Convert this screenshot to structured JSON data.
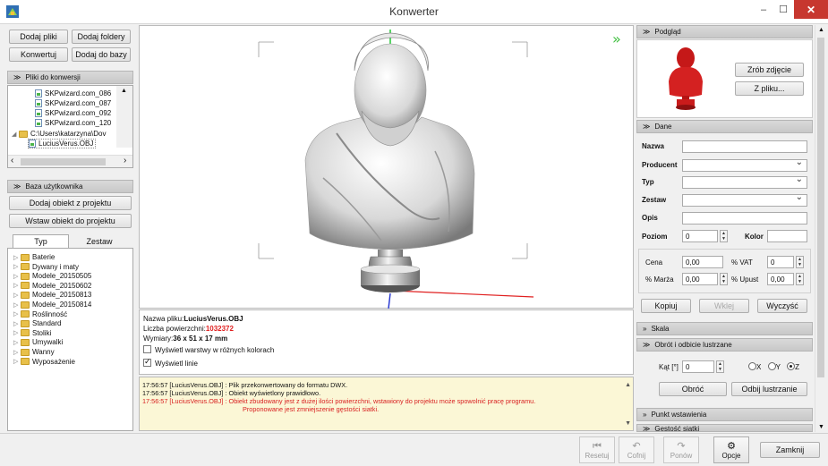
{
  "window": {
    "title": "Konwerter",
    "min": "–",
    "max": "☐",
    "close": "✕"
  },
  "left": {
    "buttons": {
      "add_files": "Dodaj pliki",
      "add_folders": "Dodaj foldery",
      "convert": "Konwertuj",
      "add_to_db": "Dodaj do bazy"
    },
    "files_section": "Pliki do konwersji",
    "files": [
      "SKPwizard.com_086",
      "SKPwizard.com_087",
      "SKPwizard.com_092",
      "SKPwizard.com_120"
    ],
    "folder_path": "C:\\Users\\katarzyna\\Dov",
    "selected_file": "LuciusVerus.OBJ",
    "user_db_section": "Baza użytkownika",
    "add_from_project": "Dodaj obiekt z projektu",
    "insert_to_project": "Wstaw obiekt do projektu",
    "tabs": [
      "Typ",
      "Zestaw"
    ],
    "categories": [
      "Baterie",
      "Dywany i maty",
      "Modele_20150505",
      "Modele_20150602",
      "Modele_20150813",
      "Modele_20150814",
      "Roślinność",
      "Standard",
      "Stoliki",
      "Umywalki",
      "Wanny",
      "Wyposażenie"
    ]
  },
  "info": {
    "filename_label": "Nazwa pliku:",
    "filename": "LuciusVerus.OBJ",
    "faces_label": "Liczba powierzchni:",
    "faces": "1032372",
    "dims_label": "Wymiary:",
    "dims": "36 x 51 x 17 mm",
    "layers_check": "Wyświetl warstwy w różnych kolorach",
    "lines_check": "Wyświetl linie"
  },
  "log": [
    {
      "text": "17:56:57 [LuciusVerus.OBJ] : Plik przekonwertowany do formatu DWX.",
      "error": false
    },
    {
      "text": "17:56:57 [LuciusVerus.OBJ] : Obiekt wyświetlony prawidłowo.",
      "error": false
    },
    {
      "text": "17:56:57 [LuciusVerus.OBJ] : Obiekt zbudowany jest z dużej ilości powierzchni, wstawiony do projektu może spowolnić pracę programu.",
      "error": true
    },
    {
      "text": "Proponowane jest zmniejszenie gęstości siatki.",
      "error": true
    }
  ],
  "right": {
    "preview_section": "Podgląd",
    "take_photo": "Zrób zdjęcie",
    "from_file": "Z pliku...",
    "data_section": "Dane",
    "fields": {
      "name": "Nazwa",
      "producer": "Producent",
      "type": "Typ",
      "set": "Zestaw",
      "desc": "Opis",
      "level": "Poziom",
      "level_value": "0",
      "color": "Kolor"
    },
    "price": {
      "price_label": "Cena",
      "price": "0,00",
      "vat_label": "% VAT",
      "vat": "0",
      "margin_label": "% Marża",
      "margin": "0,00",
      "discount_label": "% Upust",
      "discount": "0,00"
    },
    "copy": "Kopiuj",
    "paste": "Wklej",
    "clear": "Wyczyść",
    "scale_section": "Skala",
    "rotate_section": "Obrót i odbicie lustrzane",
    "angle_label": "Kąt [°]",
    "angle": "0",
    "axes": [
      "X",
      "Y",
      "Z"
    ],
    "axis_selected": "Z",
    "rotate": "Obróć",
    "mirror": "Odbij lustrzanie",
    "insert_point_section": "Punkt wstawienia",
    "mesh_section": "Gęstość siatki"
  },
  "toolbar": {
    "reset": "Resetuj",
    "undo": "Cofnij",
    "redo": "Ponów",
    "options": "Opcje",
    "close": "Zamknij"
  }
}
